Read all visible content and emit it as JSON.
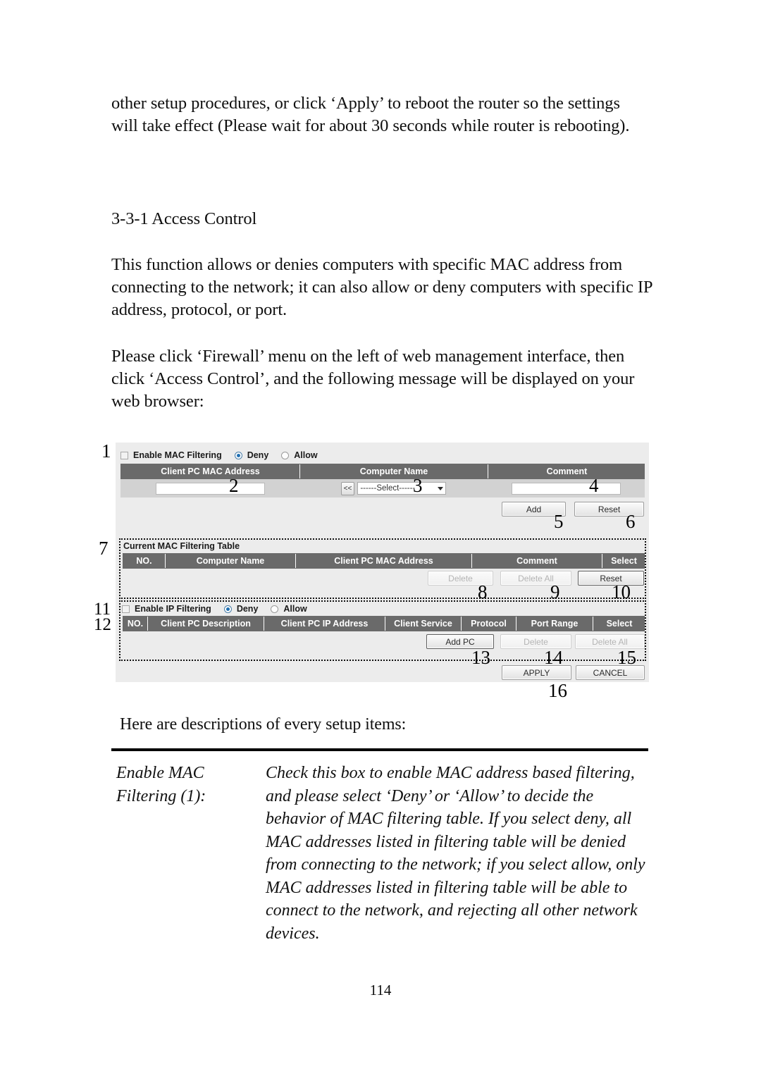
{
  "document": {
    "page_number": "114",
    "intro_paragraph": "other setup procedures, or click ‘Apply’ to reboot the router so the settings will take effect (Please wait for about 30 seconds while router is rebooting).",
    "section_heading": "3-3-1 Access Control",
    "function_paragraph": "This function allows or denies computers with specific MAC address from connecting to the network; it can also allow or deny computers with specific IP address, protocol, or port.",
    "instruction_paragraph": "Please click ‘Firewall’ menu on the left of web management interface, then click ‘Access Control’, and the following message will be displayed on your web browser:",
    "descriptions_lead": "Here are descriptions of every setup items:"
  },
  "descriptions": [
    {
      "term": "Enable MAC Filtering (1):",
      "body": "Check this box to enable MAC address based filtering, and please select ‘Deny’ or ‘Allow’ to decide the behavior of MAC filtering table. If you select deny, all MAC addresses listed in filtering table will be denied from connecting to the network; if you select allow, only MAC addresses listed in filtering table will be able to connect to the network, and rejecting all other network devices."
    }
  ],
  "screenshot": {
    "mac_filter": {
      "enable_label": "Enable MAC Filtering",
      "deny_label": "Deny",
      "allow_label": "Allow",
      "enable_checked": false,
      "selected_mode": "Deny",
      "headers": [
        "Client PC MAC Address",
        "Computer Name",
        "Comment"
      ],
      "mac_input_value": "",
      "comment_input_value": "",
      "shift_button_label": "<<",
      "select_value": "------Select------",
      "add_button": "Add",
      "reset_button": "Reset"
    },
    "mac_table": {
      "title": "Current MAC Filtering Table",
      "headers": [
        "NO.",
        "Computer Name",
        "Client PC MAC Address",
        "Comment",
        "Select"
      ],
      "rows": [],
      "delete_button": "Delete",
      "delete_all_button": "Delete All",
      "reset_button": "Reset"
    },
    "ip_filter": {
      "enable_label": "Enable IP Filtering",
      "deny_label": "Deny",
      "allow_label": "Allow",
      "enable_checked": false,
      "selected_mode": "Deny",
      "headers": [
        "NO.",
        "Client PC Description",
        "Client PC IP Address",
        "Client Service",
        "Protocol",
        "Port Range",
        "Select"
      ],
      "rows": [],
      "add_pc_button": "Add PC",
      "delete_button": "Delete",
      "delete_all_button": "Delete All"
    },
    "footer": {
      "apply_button": "APPLY",
      "cancel_button": "CANCEL"
    },
    "annotations": [
      "1",
      "2",
      "3",
      "4",
      "5",
      "6",
      "7",
      "8",
      "9",
      "10",
      "11",
      "12",
      "13",
      "14",
      "15",
      "16"
    ],
    "colors": {
      "header_bg": "#6a6a6a",
      "panel_bg": "#ececec",
      "row_bg": "#d2d2d2",
      "radio_accent": "#1f6fb2"
    }
  }
}
